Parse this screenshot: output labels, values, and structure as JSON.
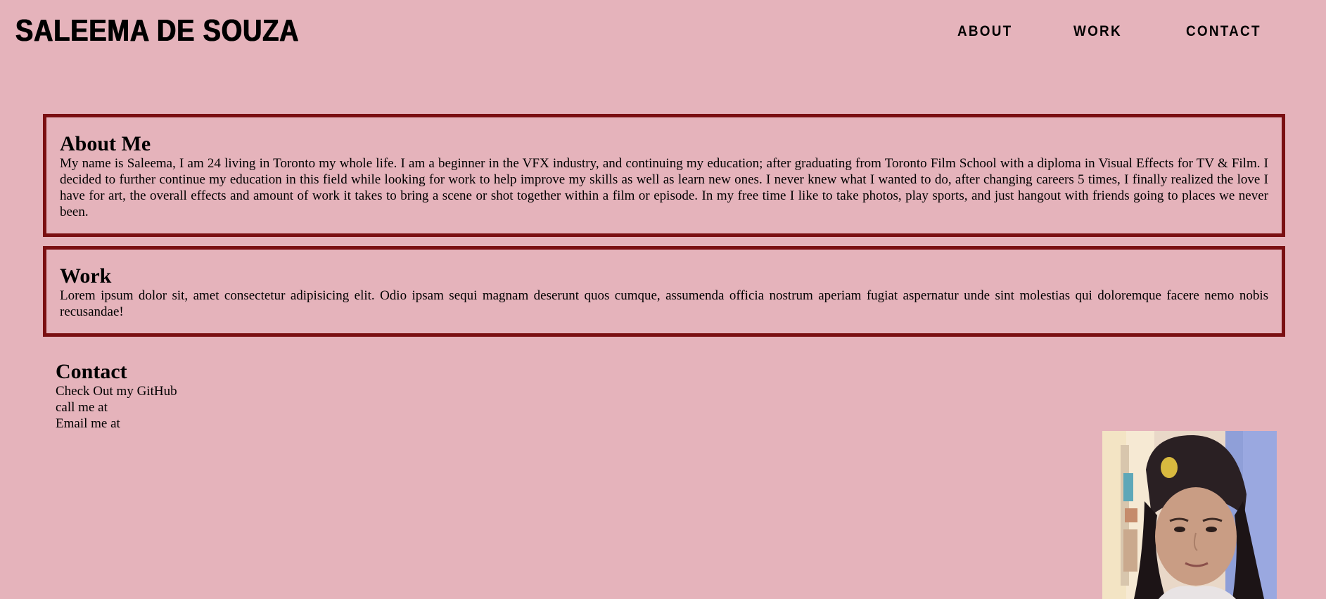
{
  "header": {
    "site_title": "SALEEMA DE SOUZA",
    "nav": [
      {
        "label": "ABOUT"
      },
      {
        "label": "WORK"
      },
      {
        "label": "CONTACT"
      }
    ]
  },
  "about": {
    "heading": "About Me",
    "text": "My name is Saleema, I am 24 living in Toronto my whole life. I am a beginner in the VFX industry, and continuing my education; after graduating from Toronto Film School with a diploma in Visual Effects for TV & Film. I decided to further continue my education in this field while looking for work to help improve my skills as well as learn new ones. I never knew what I wanted to do, after changing careers 5 times, I finally realized the love I have for art, the overall effects and amount of work it takes to bring a scene or shot together within a film or episode. In my free time I like to take photos, play sports, and just hangout with friends going to places we never been."
  },
  "work": {
    "heading": "Work",
    "text": "Lorem ipsum dolor sit, amet consectetur adipisicing elit. Odio ipsam sequi magnam deserunt quos cumque, assumenda officia nostrum aperiam fugiat aspernatur unde sint molestias qui doloremque facere nemo nobis recusandae!"
  },
  "contact": {
    "heading": "Contact",
    "github": "Check Out my GitHub",
    "phone": "call me at",
    "email": "Email me at"
  },
  "colors": {
    "background": "#e5b3bb",
    "panel_border": "#7a0f12"
  }
}
